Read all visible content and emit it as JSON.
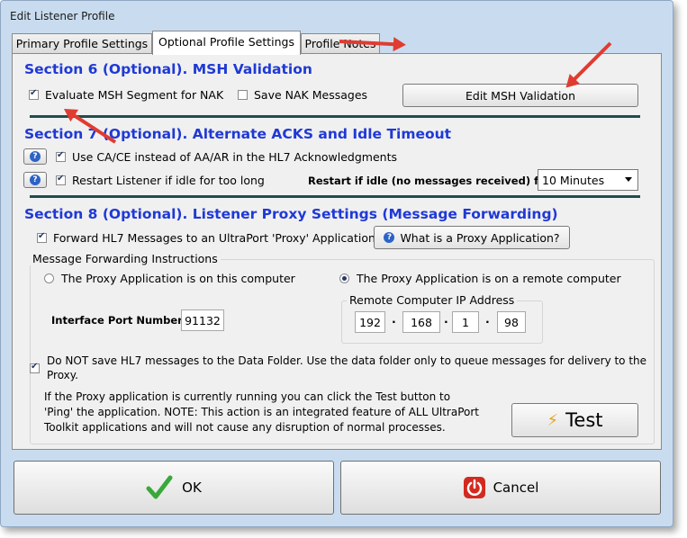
{
  "window": {
    "title": "Edit Listener Profile"
  },
  "tabs": [
    "Primary Profile Settings",
    "Optional Profile Settings",
    "Profile Notes"
  ],
  "section6": {
    "title": "Section 6 (Optional). MSH Validation",
    "evaluate_label": "Evaluate MSH Segment for NAK",
    "save_nak_label": "Save NAK Messages",
    "edit_button": "Edit MSH Validation"
  },
  "section7": {
    "title": "Section 7 (Optional). Alternate ACKS and Idle Timeout",
    "use_ca_label": "Use CA/CE instead of AA/AR in the HL7 Acknowledgments",
    "restart_label": "Restart Listener if idle for too long",
    "idle_label": "Restart if idle (no messages received) for:",
    "idle_value": "10 Minutes"
  },
  "section8": {
    "title": "Section 8 (Optional). Listener Proxy Settings (Message Forwarding)",
    "forward_label": "Forward HL7 Messages to an UltraPort 'Proxy' Application",
    "what_is_button": "What is a Proxy Application?",
    "group_label": "Message Forwarding Instructions",
    "radio_local": "The Proxy Application is on this computer",
    "radio_remote": "The Proxy Application is on a remote computer",
    "ip_group_label": "Remote Computer IP Address",
    "port_label": "Interface Port Number",
    "port_value": "91132",
    "ip": [
      "192",
      "168",
      "1",
      "98"
    ],
    "dns_label_1": "Do NOT save HL7 messages to the Data Folder. Use the data folder only to queue messages for delivery to the",
    "dns_label_2": "Proxy.",
    "info_1": "If the Proxy application is currently running you can click  the Test button to",
    "info_2": "'Ping' the application.  NOTE: This action is an integrated feature of ALL UltraPort",
    "info_3": "Toolkit applications and will not cause any disruption of normal processes.",
    "test_button": "Test"
  },
  "footer": {
    "ok": "OK",
    "cancel": "Cancel"
  },
  "colors": {
    "section_title": "#1f39d6",
    "window_bg": "#c9dcef",
    "annotation_arrow": "#e03c31"
  }
}
